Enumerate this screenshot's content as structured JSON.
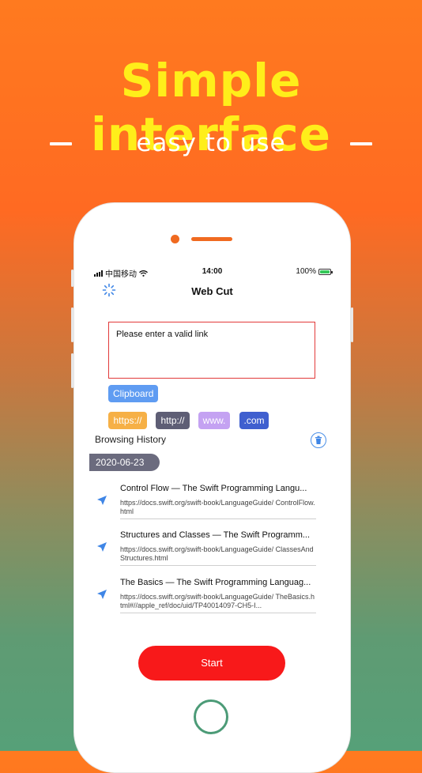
{
  "promo": {
    "headline": "Simple interface",
    "subline": "easy to use"
  },
  "status_bar": {
    "carrier": "中国移动",
    "time": "14:00",
    "battery": "100%"
  },
  "nav": {
    "title": "Web Cut"
  },
  "link_input": {
    "placeholder": "Please enter a valid link"
  },
  "clipboard_label": "Clipboard",
  "chips": [
    {
      "label": "https://",
      "color": "#f6b046"
    },
    {
      "label": "http://",
      "color": "#5e5e75"
    },
    {
      "label": "www.",
      "color": "#c4a2f2"
    },
    {
      "label": ".com",
      "color": "#3f5fcf"
    }
  ],
  "history": {
    "title": "Browsing History",
    "date": "2020-06-23",
    "items": [
      {
        "title": "Control Flow — The Swift Programming Langu...",
        "url": "https://docs.swift.org/swift-book/LanguageGuide/ ControlFlow.html"
      },
      {
        "title": "Structures and Classes — The Swift Programm...",
        "url": "https://docs.swift.org/swift-book/LanguageGuide/ ClassesAndStructures.html"
      },
      {
        "title": "The Basics — The Swift Programming Languag...",
        "url": "https://docs.swift.org/swift-book/LanguageGuide/ TheBasics.html#//apple_ref/doc/uid/TP40014097-CH5-I..."
      }
    ]
  },
  "start_label": "Start",
  "colors": {
    "accent_blue": "#4a8fe7",
    "start_red": "#f8191a",
    "headline_yellow": "#ffee1a"
  }
}
